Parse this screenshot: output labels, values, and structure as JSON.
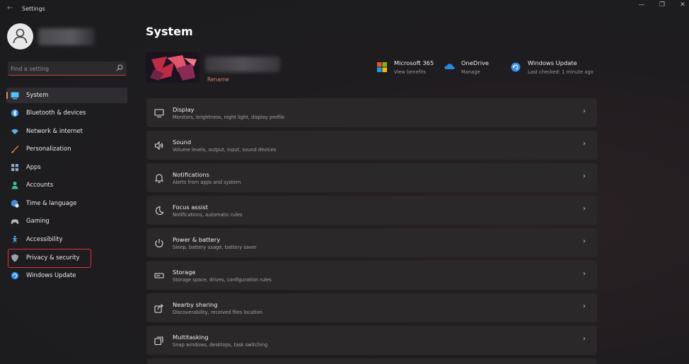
{
  "window": {
    "back_glyph": "←",
    "title": "Settings",
    "minimize_glyph": "—",
    "maximize_glyph": "❐",
    "close_glyph": "✕"
  },
  "search": {
    "placeholder": "Find a setting",
    "value": ""
  },
  "sidebar": {
    "items": [
      {
        "label": "System",
        "icon": "system-icon",
        "active": true,
        "color": "#4cc2ff"
      },
      {
        "label": "Bluetooth & devices",
        "icon": "bluetooth-icon",
        "active": false,
        "color": "#3a8ee6"
      },
      {
        "label": "Network & internet",
        "icon": "wifi-icon",
        "active": false,
        "color": "#59b4ea"
      },
      {
        "label": "Personalization",
        "icon": "brush-icon",
        "active": false,
        "color": "#e8804a"
      },
      {
        "label": "Apps",
        "icon": "apps-icon",
        "active": false,
        "color": "#9aa7b5"
      },
      {
        "label": "Accounts",
        "icon": "accounts-icon",
        "active": false,
        "color": "#39c18a"
      },
      {
        "label": "Time & language",
        "icon": "globe-clock-icon",
        "active": false,
        "color": "#3c8fe0"
      },
      {
        "label": "Gaming",
        "icon": "controller-icon",
        "active": false,
        "color": "#b8b8b8"
      },
      {
        "label": "Accessibility",
        "icon": "accessibility-icon",
        "active": false,
        "color": "#4aa8f0"
      },
      {
        "label": "Privacy & security",
        "icon": "shield-icon",
        "active": false,
        "color": "#9aa0a8"
      },
      {
        "label": "Windows Update",
        "icon": "update-icon",
        "active": false,
        "color": "#2f8ff0"
      }
    ]
  },
  "main": {
    "title": "System",
    "device": {
      "rename": "Rename"
    },
    "quick_links": [
      {
        "title": "Microsoft 365",
        "sub": "View benefits",
        "icon": "microsoft-365-icon"
      },
      {
        "title": "OneDrive",
        "sub": "Manage",
        "icon": "onedrive-icon"
      },
      {
        "title": "Windows Update",
        "sub": "Last checked: 1 minute ago",
        "icon": "windows-update-icon"
      }
    ],
    "settings": [
      {
        "title": "Display",
        "sub": "Monitors, brightness, night light, display profile",
        "icon": "display-icon"
      },
      {
        "title": "Sound",
        "sub": "Volume levels, output, input, sound devices",
        "icon": "speaker-icon"
      },
      {
        "title": "Notifications",
        "sub": "Alerts from apps and system",
        "icon": "bell-icon"
      },
      {
        "title": "Focus assist",
        "sub": "Notifications, automatic rules",
        "icon": "moon-icon"
      },
      {
        "title": "Power & battery",
        "sub": "Sleep, battery usage, battery saver",
        "icon": "power-icon"
      },
      {
        "title": "Storage",
        "sub": "Storage space, drives, configuration rules",
        "icon": "storage-icon"
      },
      {
        "title": "Nearby sharing",
        "sub": "Discoverability, received files location",
        "icon": "share-icon"
      },
      {
        "title": "Multitasking",
        "sub": "Snap windows, desktops, task switching",
        "icon": "multitask-icon"
      }
    ],
    "chevron_glyph": "›"
  },
  "colors": {
    "accent": "#ff7b56",
    "highlight_box": "#e0343b",
    "card_bg": "#2a2829"
  }
}
